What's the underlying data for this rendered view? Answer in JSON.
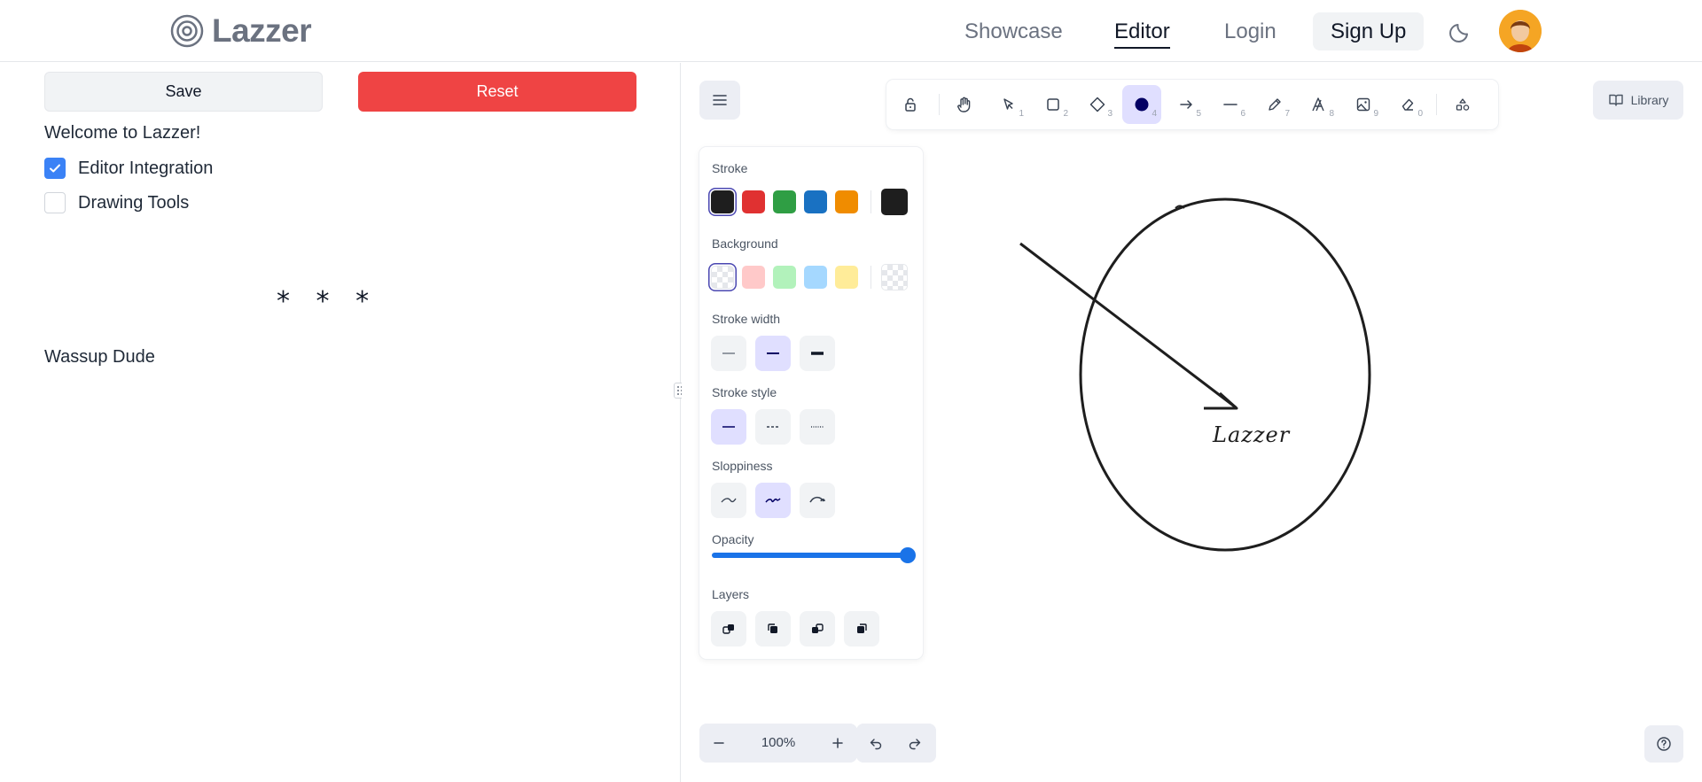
{
  "header": {
    "brand": "Lazzer",
    "nav": {
      "showcase": "Showcase",
      "editor": "Editor",
      "login": "Login",
      "signup": "Sign Up"
    }
  },
  "left": {
    "save_label": "Save",
    "reset_label": "Reset",
    "welcome": "Welcome to Lazzer!",
    "checklist": [
      {
        "label": "Editor Integration",
        "checked": true
      },
      {
        "label": "Drawing Tools",
        "checked": false
      }
    ],
    "separator": "* * *",
    "note": "Wassup Dude"
  },
  "editor": {
    "library_label": "Library",
    "tools": [
      {
        "icon": "lock-icon",
        "key": ""
      },
      {
        "icon": "hand-icon",
        "key": ""
      },
      {
        "icon": "select-cursor-icon",
        "key": "1"
      },
      {
        "icon": "rectangle-icon",
        "key": "2"
      },
      {
        "icon": "diamond-icon",
        "key": "3"
      },
      {
        "icon": "ellipse-icon",
        "key": "4",
        "active": true
      },
      {
        "icon": "arrow-icon",
        "key": "5"
      },
      {
        "icon": "line-icon",
        "key": "6"
      },
      {
        "icon": "pencil-icon",
        "key": "7"
      },
      {
        "icon": "text-icon",
        "key": "8"
      },
      {
        "icon": "image-icon",
        "key": "9"
      },
      {
        "icon": "eraser-icon",
        "key": "0"
      },
      {
        "icon": "extra-tools-icon",
        "key": ""
      }
    ],
    "panel": {
      "stroke_label": "Stroke",
      "background_label": "Background",
      "stroke_width_label": "Stroke width",
      "stroke_style_label": "Stroke style",
      "sloppiness_label": "Sloppiness",
      "opacity_label": "Opacity",
      "layers_label": "Layers",
      "stroke_colors": [
        "#1e1e1e",
        "#e03131",
        "#2f9e44",
        "#1971c2",
        "#f08c00"
      ],
      "stroke_current": "#1e1e1e",
      "background_colors": [
        "transparent",
        "#ffc9c9",
        "#b2f2bb",
        "#a5d8ff",
        "#ffec99"
      ],
      "background_current": "transparent",
      "opacity": 100
    },
    "zoom": "100%",
    "canvas_text": "Lazzer"
  },
  "colors": {
    "accent": "#3b82f6",
    "reset": "#ef4444",
    "active_tool": "#e0dfff",
    "slider": "#1a73e8"
  }
}
